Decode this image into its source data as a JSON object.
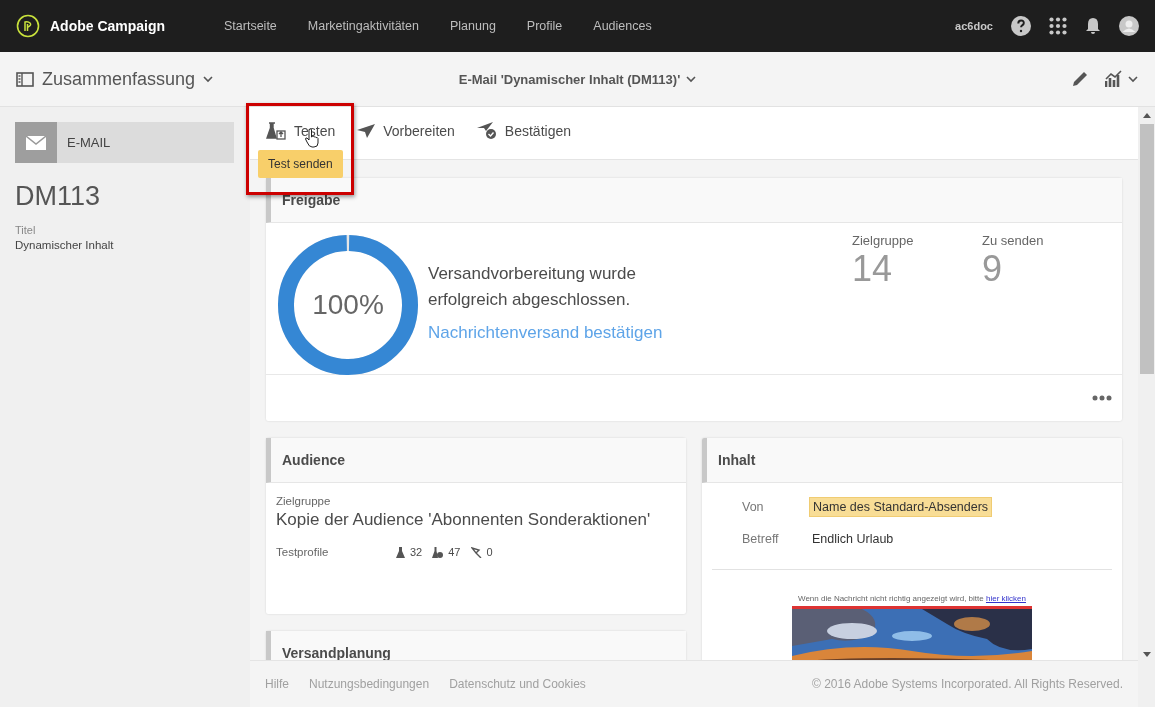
{
  "topbar": {
    "brand": "Adobe Campaign",
    "nav": [
      {
        "label": "Startseite",
        "selected": false
      },
      {
        "label": "Marketingaktivitäten",
        "selected": false
      },
      {
        "label": "Planung",
        "selected": false
      },
      {
        "label": "Profile",
        "selected": false
      },
      {
        "label": "Audiences",
        "selected": false
      }
    ],
    "user": "ac6doc"
  },
  "subheader": {
    "view": "Zusammenfassung",
    "title": "E-Mail 'Dynamischer Inhalt (DM113)'"
  },
  "sidebar": {
    "type": "E-MAIL",
    "code": "DM113",
    "fields": [
      {
        "label": "Titel",
        "value": "Dynamischer Inhalt"
      }
    ]
  },
  "toolbar": {
    "actions": [
      {
        "kind": "test",
        "label": "Testen",
        "highlighted": true
      },
      {
        "kind": "prepare",
        "label": "Vorbereiten",
        "highlighted": false
      },
      {
        "kind": "confirm",
        "label": "Bestätigen",
        "highlighted": false
      }
    ],
    "tooltip": "Test senden"
  },
  "approval": {
    "title": "Freigabe",
    "level": 1,
    "percent": "100%",
    "message": "Versandvorbereitung wurde erfolgreich abgeschlossen.",
    "link": "Nachrichtenversand bestätigen",
    "stats": [
      {
        "label": "Zielgruppe",
        "value": "14"
      },
      {
        "label": "Zu senden",
        "value": "9"
      }
    ]
  },
  "audience": {
    "title": "Audience",
    "label": "Zielgruppe",
    "value": "Kopie der Audience 'Abonnenten Sonderaktionen'",
    "test_label": "Testprofile",
    "counts": [
      {
        "kind": "flask",
        "value": "32"
      },
      {
        "kind": "flask-check",
        "value": "47"
      },
      {
        "kind": "pin",
        "value": "0"
      }
    ]
  },
  "content": {
    "title": "Inhalt",
    "rows": [
      {
        "label": "Von",
        "value": "Name des Standard-Absenders",
        "highlighted": true
      },
      {
        "label": "Betreff",
        "value": "Endlich Urlaub",
        "highlighted": false
      }
    ],
    "preview_note": "Wenn die Nachricht nicht richtig angezeigt wird, bitte",
    "preview_link": "hier klicken"
  },
  "schedule": {
    "title": "Versandplanung"
  },
  "footer": {
    "links": [
      "Hilfe",
      "Nutzungsbedingungen",
      "Datenschutz und Cookies"
    ],
    "copyright": "© 2016 Adobe Systems Incorporated. All Rights Reserved."
  }
}
